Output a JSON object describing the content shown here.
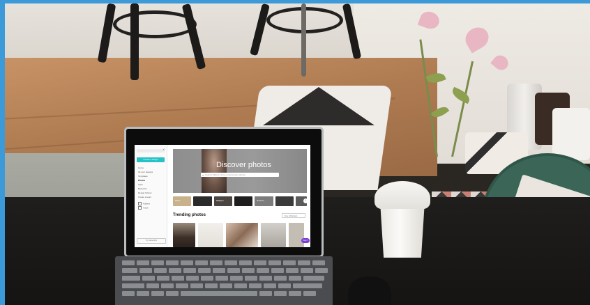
{
  "sidebar": {
    "create_label": "Create a design",
    "items": [
      "Home",
      "All your designs",
      "Templates",
      "Photos",
      "Apps",
      "Brand Kit",
      "Design School",
      "Create a team"
    ],
    "active_index": 3,
    "bottom_items": [
      "Folders",
      "Trash"
    ],
    "bottom_button": "Try Canva Pro"
  },
  "hero": {
    "title": "Discover photos",
    "search_placeholder": "Search millions of free and premium photos",
    "subtitle": ""
  },
  "categories": [
    "Nature",
    "",
    "Wallpaper",
    "",
    "Business",
    "",
    ""
  ],
  "trending": {
    "title": "Trending photos",
    "filter": "Free & Premium"
  },
  "help_label": "Help ?",
  "colors": {
    "accent": "#27c2c5",
    "help": "#7b3fd6",
    "frame": "#3d9ad8"
  }
}
